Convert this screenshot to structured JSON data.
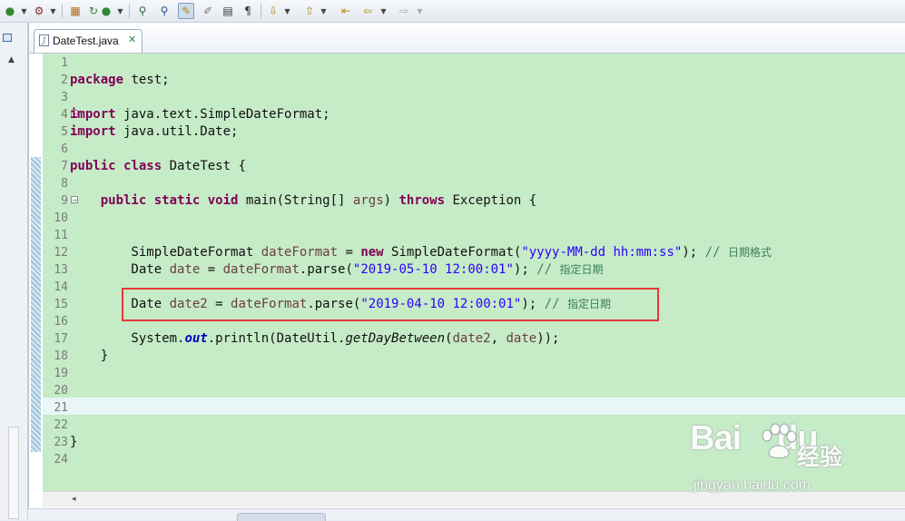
{
  "toolbar": {
    "buttons": [
      {
        "name": "debug-run-button",
        "glyph": "▶"
      },
      {
        "name": "run-config-button",
        "glyph": "▣"
      },
      {
        "name": "package-button",
        "glyph": "▦"
      },
      {
        "name": "refresh-button",
        "glyph": "↻"
      },
      {
        "name": "open-type-button",
        "glyph": "⚲"
      },
      {
        "name": "highlight-button",
        "glyph": "✎"
      },
      {
        "name": "mark-occurrences-button",
        "glyph": "✐"
      },
      {
        "name": "block-select-button",
        "glyph": "▤"
      },
      {
        "name": "show-whitespace-button",
        "glyph": "¶"
      },
      {
        "name": "next-annotation-button",
        "glyph": "⇩"
      },
      {
        "name": "prev-annotation-button",
        "glyph": "⇧"
      },
      {
        "name": "last-edit-button",
        "glyph": "⇤"
      },
      {
        "name": "back-button",
        "glyph": "⇦"
      },
      {
        "name": "forward-button",
        "glyph": "⇨"
      }
    ]
  },
  "editor": {
    "tab_title": "DateTest.java",
    "tab_close": "✕",
    "file_icon": "J"
  },
  "line_numbers": [
    "1",
    "2",
    "3",
    "4",
    "5",
    "6",
    "7",
    "8",
    "9",
    "10",
    "11",
    "12",
    "13",
    "14",
    "15",
    "16",
    "17",
    "18",
    "19",
    "20",
    "21",
    "22",
    "23",
    "24"
  ],
  "code": {
    "l2_kw": "package",
    "l2_rest": " test;",
    "l4_kw": "import",
    "l4_rest": " java.text.SimpleDateFormat;",
    "l5_kw": "import",
    "l5_rest": " java.util.Date;",
    "l7_kw1": "public",
    "l7_kw2": "class",
    "l7_rest": " DateTest {",
    "l9_indent": "    ",
    "l9_kw1": "public",
    "l9_kw2": "static",
    "l9_kw3": "void",
    "l9_a": " main(String[] ",
    "l9_args": "args",
    "l9_b": ") ",
    "l9_kw4": "throws",
    "l9_c": " Exception {",
    "l12_a": "        SimpleDateFormat ",
    "l12_var": "dateFormat",
    "l12_b": " = ",
    "l12_kw": "new",
    "l12_c": " SimpleDateFormat(",
    "l12_str": "\"yyyy-MM-dd hh:mm:ss\"",
    "l12_d": "); ",
    "l12_cm": "// ",
    "l12_cn": "日期格式",
    "l13_a": "        Date ",
    "l13_var": "date",
    "l13_b": " = ",
    "l13_var2": "dateFormat",
    "l13_c": ".parse(",
    "l13_str": "\"2019-05-10 12:00:01\"",
    "l13_d": "); ",
    "l13_cm": "// ",
    "l13_cn": "指定日期",
    "l15_a": "        Date ",
    "l15_var": "date2",
    "l15_b": " = ",
    "l15_var2": "dateFormat",
    "l15_c": ".parse(",
    "l15_str": "\"2019-04-10 12:00:01\"",
    "l15_d": "); ",
    "l15_cm": "// ",
    "l15_cn": "指定日期",
    "l17_a": "        System.",
    "l17_field": "out",
    "l17_b": ".println(DateUtil.",
    "l17_m": "getDayBetween",
    "l17_c": "(",
    "l17_v1": "date2",
    "l17_d": ", ",
    "l17_v2": "date",
    "l17_e": "));",
    "l18": "    }",
    "l23": "}"
  },
  "watermark": {
    "brand": "Bai",
    "brand2": "du",
    "cn": "经验",
    "url": "jingyan.baidu.com"
  }
}
